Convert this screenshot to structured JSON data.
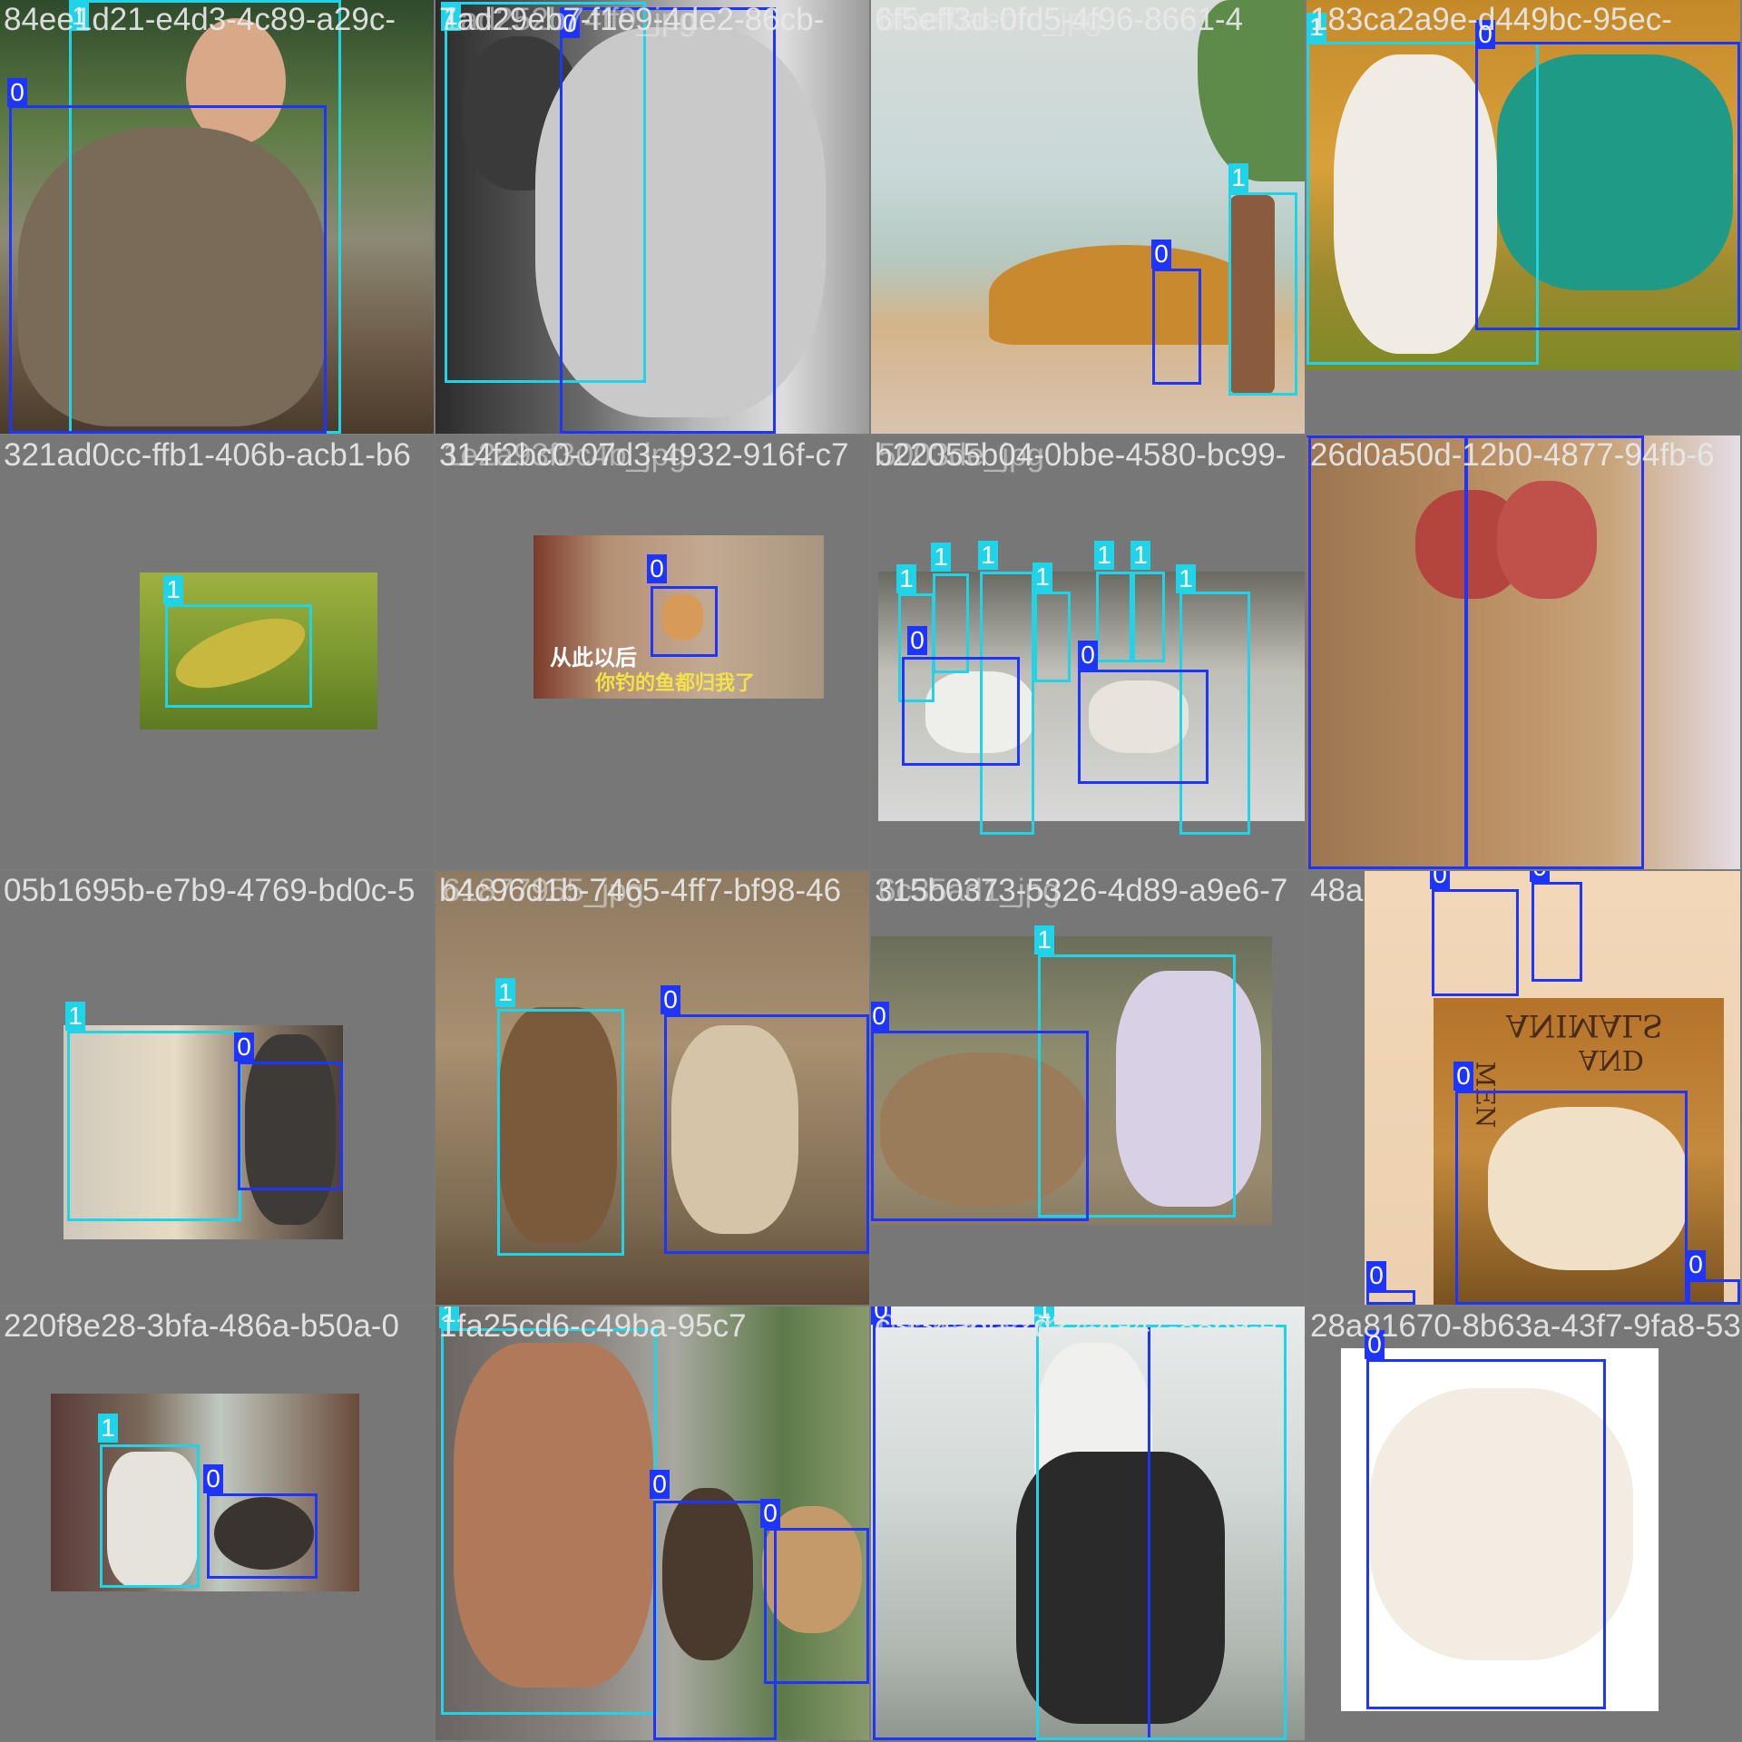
{
  "mosaic": {
    "colors": {
      "class0": "#1d35ff",
      "class1": "#1fd4e8",
      "padding": "#777777",
      "text": "#e9e9e9"
    },
    "tiles": [
      {
        "id": "t1",
        "filename": "84ee1d21-e4d3-4c89-a29c-",
        "subject": "man holding wombat",
        "boxes": [
          {
            "label": "1"
          },
          {
            "label": "0"
          }
        ]
      },
      {
        "id": "t2",
        "filename": "7ad29eb7-f1e9-4de2-86cb-",
        "overlay": "1ad252b74ff9_jpg",
        "subject": "man kissing lion (black and white)",
        "boxes": [
          {
            "label": "1"
          },
          {
            "label": "0"
          }
        ]
      },
      {
        "id": "t3",
        "filename": "6f5eff3d-0fd5-4f96-8661-4",
        "overlay": "bfbef0acbfc_jpg",
        "subject": "illustration of man with dog",
        "boxes": [
          {
            "label": "0"
          },
          {
            "label": "1"
          }
        ]
      },
      {
        "id": "t4",
        "filename": "183ca2a9e-d449bc-95ec-",
        "subject": "boy with husky",
        "boxes": [
          {
            "label": "1"
          },
          {
            "label": "0"
          }
        ]
      },
      {
        "id": "t5",
        "filename": "321ad0cc-ffb1-406b-acb1-b6",
        "subject": "snake in grass",
        "boxes": [
          {
            "label": "1"
          }
        ]
      },
      {
        "id": "t6",
        "filename": "314f2bc0-07d3-4932-916f-c7",
        "overlay": "1e2a93f3c4b_jpg",
        "subject": "cat on pavement",
        "caption1": "从此以后",
        "caption2": "你钓的鱼都归我了",
        "boxes": [
          {
            "label": "0"
          }
        ]
      },
      {
        "id": "t7",
        "filename": "b22055b04-0bbe-4580-bc99-",
        "overlay": "5003de_jpg",
        "subject": "people walking dogs",
        "boxes": [
          {
            "label": "1"
          },
          {
            "label": "1"
          },
          {
            "label": "1"
          },
          {
            "label": "1"
          },
          {
            "label": "1"
          },
          {
            "label": "1"
          },
          {
            "label": "1"
          },
          {
            "label": "0"
          },
          {
            "label": "0"
          }
        ]
      },
      {
        "id": "t8",
        "filename": "26d0a50d-12b0-4877-94fb-6",
        "subject": "two monkeys",
        "boxes": [
          {
            "label": "0"
          },
          {
            "label": "0"
          }
        ]
      },
      {
        "id": "t9",
        "filename": "05b1695b-e7b9-4769-bd0c-5",
        "subject": "elderly woman with cat",
        "boxes": [
          {
            "label": "1"
          },
          {
            "label": "0"
          }
        ]
      },
      {
        "id": "t10",
        "filename": "b4c96d1b-7465-4ff7-bf98-46",
        "overlay": "61877955_jpg",
        "subject": "boy and siamese cat",
        "boxes": [
          {
            "label": "1"
          },
          {
            "label": "0"
          }
        ]
      },
      {
        "id": "t11",
        "filename": "315b0373-5326-4d89-a9e6-7",
        "overlay": "6c35ad1_jpg",
        "subject": "woman petting capybara",
        "boxes": [
          {
            "label": "1"
          },
          {
            "label": "0"
          }
        ]
      },
      {
        "id": "t12",
        "filename": "48a",
        "subject": "book Animals and Men",
        "book_title_1": "ANIMALS",
        "book_title_2": "AND",
        "book_title_3": "MEN",
        "boxes": [
          {
            "label": "0"
          },
          {
            "label": "0"
          },
          {
            "label": "0"
          },
          {
            "label": "0"
          },
          {
            "label": "0"
          }
        ]
      },
      {
        "id": "t13",
        "filename": "220f8e28-3bfa-486a-b50a-0",
        "subject": "woman with porcupine",
        "boxes": [
          {
            "label": "1"
          },
          {
            "label": "0"
          }
        ]
      },
      {
        "id": "t14",
        "filename": "1fa25cd6-c49ba-95c7",
        "subject": "man with chickens",
        "boxes": [
          {
            "label": "1"
          },
          {
            "label": "0"
          },
          {
            "label": "0"
          }
        ]
      },
      {
        "id": "t15",
        "filename": "c3f34a6b-2d27-4a47-8869-e",
        "overlay": "0a5fe87a63a_jpg",
        "subject": "woman in wheelchair hugging horse",
        "boxes": [
          {
            "label": "0"
          },
          {
            "label": "1"
          }
        ]
      },
      {
        "id": "t16",
        "filename": "28a81670-8b63a-43f7-9fa8-53",
        "subject": "white goat",
        "boxes": [
          {
            "label": "0"
          }
        ]
      }
    ]
  }
}
